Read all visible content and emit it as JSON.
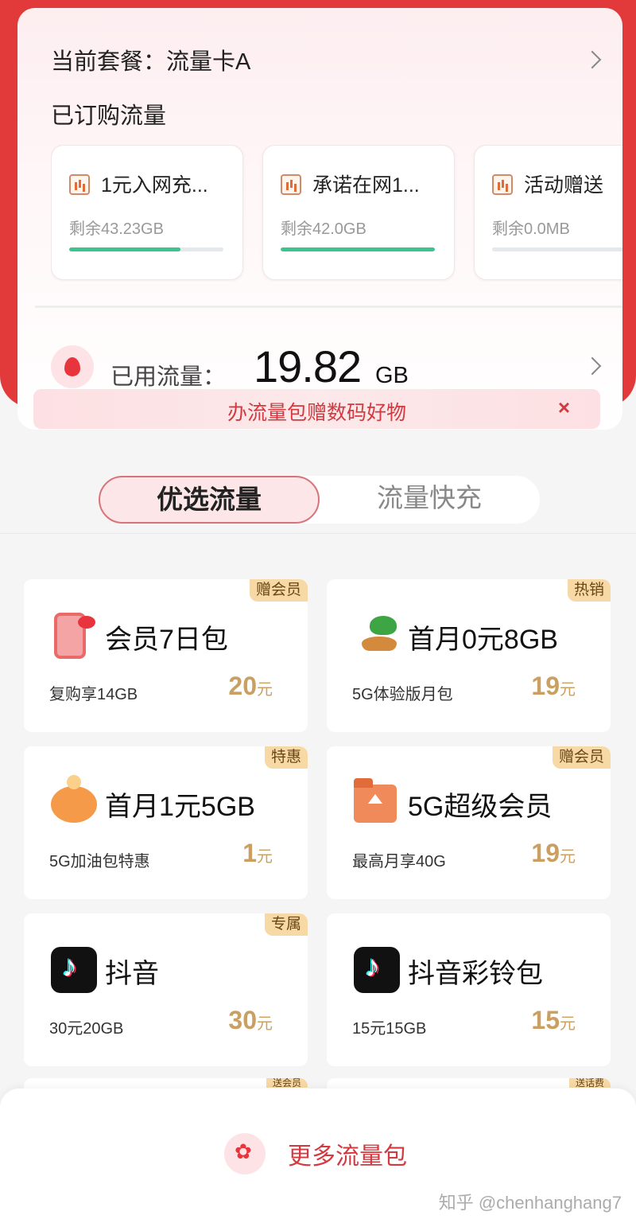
{
  "plan": {
    "label": "当前套餐：流量卡A"
  },
  "subscribed": {
    "title": "已订购流量",
    "items": [
      {
        "name": "1元入网充...",
        "remaining": "剩余43.23GB",
        "fill": 0.72
      },
      {
        "name": "承诺在网1...",
        "remaining": "剩余42.0GB",
        "fill": 1.0
      },
      {
        "name": "活动赠送",
        "remaining": "剩余0.0MB",
        "fill": 0.0
      }
    ]
  },
  "used": {
    "label": "已用流量：",
    "value": "19.82",
    "unit": "GB"
  },
  "promo": {
    "text": "办流量包赠数码好物",
    "close": "×"
  },
  "tabs": [
    {
      "label": "优选流量"
    },
    {
      "label": "流量快充"
    }
  ],
  "products": [
    {
      "name": "会员7日包",
      "desc": "复购享14GB",
      "price": "20",
      "currency": "元",
      "badge": "赠会员",
      "icon": "phone-icon"
    },
    {
      "name": "首月0元8GB",
      "desc": "5G体验版月包",
      "price": "19",
      "currency": "元",
      "badge": "热销",
      "icon": "palm-tree-icon"
    },
    {
      "name": "首月1元5GB",
      "desc": "5G加油包特惠",
      "price": "1",
      "currency": "元",
      "badge": "特惠",
      "icon": "piggy-bank-icon"
    },
    {
      "name": "5G超级会员",
      "desc": "最高月享40G",
      "price": "19",
      "currency": "元",
      "badge": "赠会员",
      "icon": "folder-upload-icon"
    },
    {
      "name": "抖音",
      "desc": "30元20GB",
      "price": "30",
      "currency": "元",
      "badge": "专属",
      "icon": "tiktok-icon"
    },
    {
      "name": "抖音彩铃包",
      "desc": "15元15GB",
      "price": "15",
      "currency": "元",
      "badge": "",
      "icon": "tiktok-icon"
    }
  ],
  "peek_badges": [
    "送会员",
    "送话费"
  ],
  "more": {
    "label": "更多流量包"
  },
  "watermark": "知乎 @chenhanghang7",
  "colors": {
    "brand_red": "#e23a3a",
    "accent_gold": "#c9a062",
    "progress_green": "#3cc48f"
  }
}
